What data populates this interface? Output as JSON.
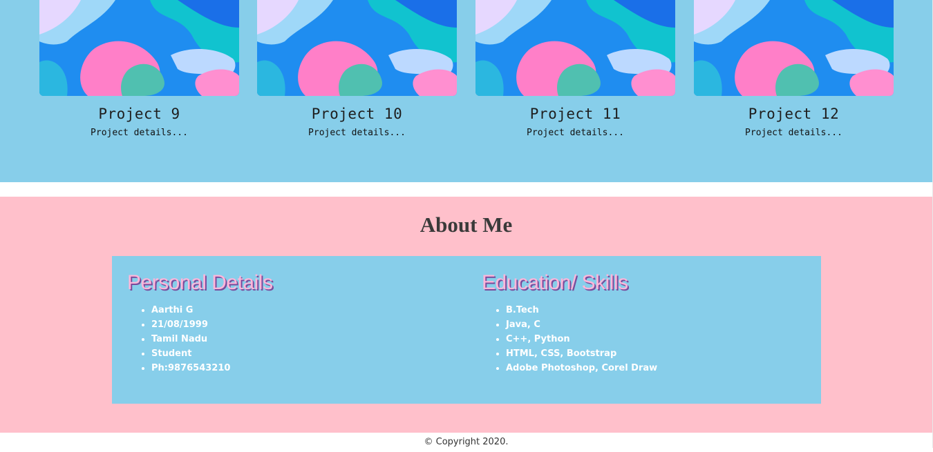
{
  "projects": [
    {
      "title": "Project 9",
      "details": "Project details..."
    },
    {
      "title": "Project 10",
      "details": "Project details..."
    },
    {
      "title": "Project 11",
      "details": "Project details..."
    },
    {
      "title": "Project 12",
      "details": "Project details..."
    }
  ],
  "about": {
    "heading": "About Me",
    "personal": {
      "heading": "Personal Details",
      "items": [
        "Aarthi G",
        "21/08/1999",
        "Tamil Nadu",
        "Student",
        "Ph:9876543210"
      ]
    },
    "education": {
      "heading": "Education/ Skills",
      "items": [
        "B.Tech",
        "Java, C",
        "C++, Python",
        "HTML, CSS, Bootstrap",
        "Adobe Photoshop, Corel Draw"
      ]
    }
  },
  "footer": {
    "copyright": "© Copyright 2020."
  },
  "colors": {
    "projects_bg": "#87ceea",
    "about_bg": "#ffc0cb",
    "panel_bg": "#87ceea",
    "subheading": "#ffb6d9"
  }
}
